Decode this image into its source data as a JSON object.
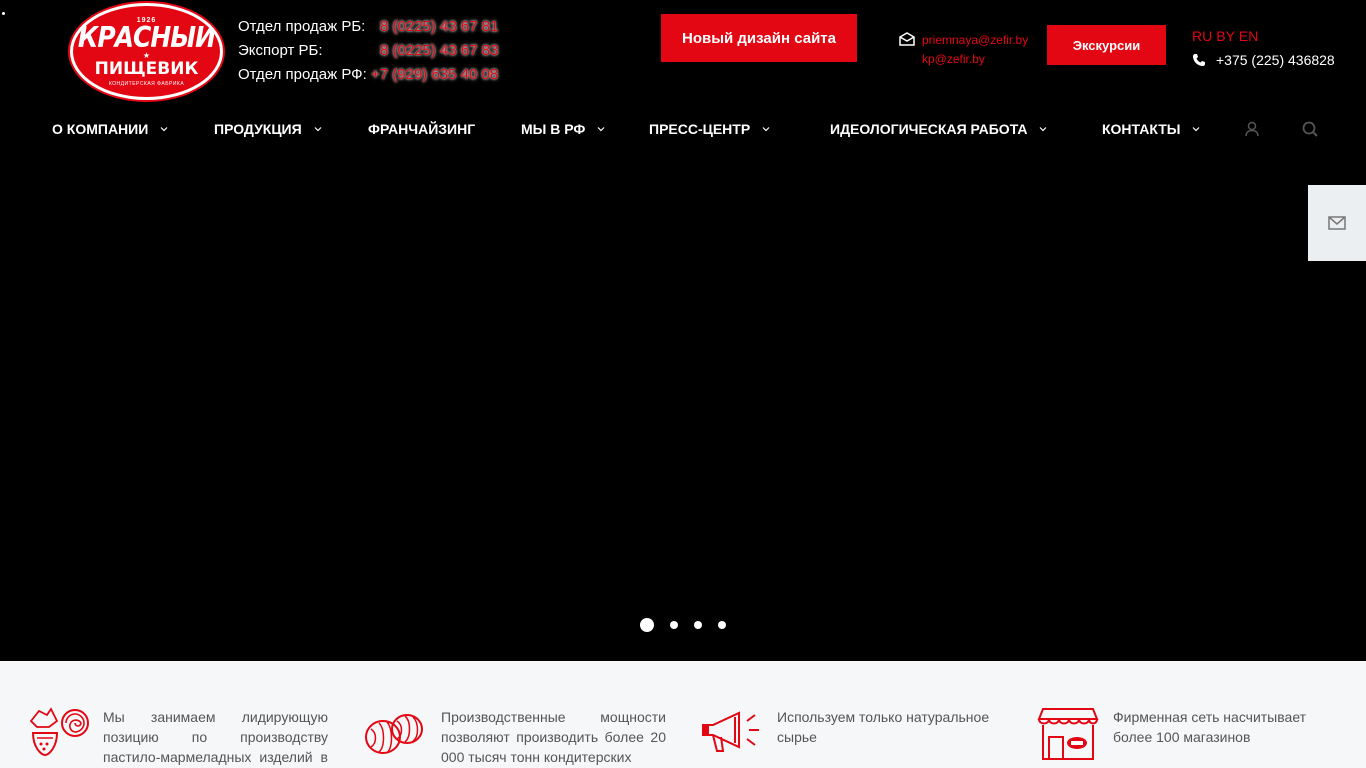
{
  "logo": {
    "year": "1926",
    "word1": "КРАСНЫЙ",
    "word2": "ПИЩЕВИК",
    "subtitle": "КОНДИТЕРСКАЯ ФАБРИКА"
  },
  "contacts": {
    "sales_rb_label": "Отдел продаж РБ:",
    "sales_rb_phone": "8 (0225) 43 67 81",
    "export_rb_label": "Экспорт РБ:",
    "export_rb_phone": "8 (0225) 43 67 83",
    "sales_rf_label": "Отдел продаж РФ:",
    "sales_rf_phone": "+7 (929) 635 40 08"
  },
  "header": {
    "new_design_button": "Новый дизайн сайта",
    "email_1": "priemnaya@zefir.by",
    "email_2": "kp@zefir.by",
    "excursions_button": "Экскурсии",
    "lang_ru": "RU",
    "lang_by": "BY",
    "lang_en": "EN",
    "main_phone": "+375 (225) 436828"
  },
  "nav": {
    "about": "О КОМПАНИИ",
    "products": "ПРОДУКЦИЯ",
    "franchise": "ФРАНЧАЙЗИНГ",
    "rf": "МЫ В РФ",
    "press": "ПРЕСС-ЦЕНТР",
    "ideology": "ИДЕОЛОГИЧЕСКАЯ РАБОТА",
    "contacts": "КОНТАКТЫ"
  },
  "slider": {
    "slides_count": 4,
    "active_index": 0
  },
  "features": [
    {
      "icon": "sweets-icon",
      "text": "Мы занимаем лидирующую позицию по производству пастило-мармеладных изделий в Беларуси"
    },
    {
      "icon": "zefir-icon",
      "text": "Производственные мощности позволяют производить более 20 000 тысяч тонн кондитерских"
    },
    {
      "icon": "megaphone-icon",
      "text": "Используем только натуральное сырье"
    },
    {
      "icon": "store-icon",
      "text": "Фирменная сеть насчитывает более 100 магазинов"
    }
  ],
  "colors": {
    "brand_red": "#e30613",
    "background": "#000000",
    "features_bg": "#f5f7f8"
  }
}
